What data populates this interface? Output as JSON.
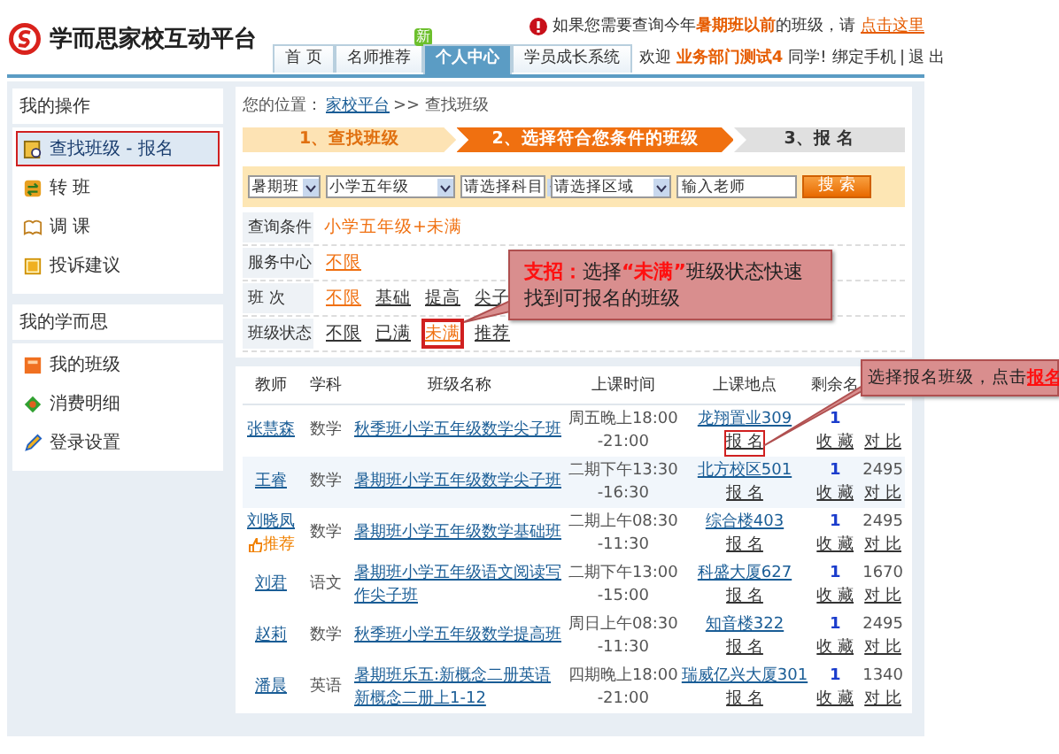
{
  "header": {
    "logo": "学而思家校互动平台",
    "notice": {
      "text": "如果您需要查询今年",
      "highlight": "暑期班以前",
      "tail": "的班级，请",
      "link": "点击这里"
    },
    "nav": [
      {
        "label": "首 页",
        "selected": false
      },
      {
        "label": "名师推荐",
        "selected": false,
        "badge": "新"
      },
      {
        "label": "个人中心",
        "selected": true
      },
      {
        "label": "学员成长系统",
        "selected": false
      }
    ],
    "welcome": {
      "greeting": "欢迎",
      "user": "业务部门测试4",
      "suffix": "同学!",
      "links": [
        "绑定手机",
        "退 出"
      ]
    }
  },
  "sidebar": [
    {
      "title": "我的操作",
      "items": [
        {
          "label": "查找班级 - 报名",
          "kind": "search",
          "selected": true,
          "annotated": true
        },
        {
          "label": "转 班",
          "kind": "swap",
          "selected": false,
          "annotated": false
        },
        {
          "label": "调 课",
          "kind": "book",
          "selected": false,
          "annotated": false
        },
        {
          "label": "投诉建议",
          "kind": "note",
          "selected": false,
          "annotated": false
        }
      ]
    },
    {
      "title": "我的学而思",
      "items": [
        {
          "label": "我的班级",
          "kind": "folder",
          "selected": false,
          "annotated": false
        },
        {
          "label": "消费明细",
          "kind": "leaf",
          "selected": false,
          "annotated": false
        },
        {
          "label": "登录设置",
          "kind": "pencil",
          "selected": false,
          "annotated": false
        }
      ]
    }
  ],
  "main": {
    "breadcrumb": {
      "prefix": "您的位置：",
      "link": "家校平台",
      "current": ">> 查找班级"
    },
    "steps": [
      {
        "label": "1、查找班级",
        "selected": false
      },
      {
        "label": "2、选择符合您条件的班级",
        "selected": true
      },
      {
        "label": "3、报 名",
        "selected": false
      }
    ],
    "search": {
      "selects": [
        "暑期班",
        "小学五年级",
        "请选择科目",
        "请选择区域"
      ],
      "teacher": {
        "placeholder": "输入老师"
      },
      "button": "搜 索"
    },
    "filters": [
      {
        "label": "查询条件",
        "kind": "text",
        "value": "小学五年级+未满"
      },
      {
        "label": "服务中心",
        "kind": "options",
        "options": [
          {
            "label": "不限",
            "selected": true,
            "annotated": false
          }
        ]
      },
      {
        "label": "班  次",
        "kind": "options",
        "options": [
          {
            "label": "不限",
            "selected": true,
            "annotated": false
          },
          {
            "label": "基础",
            "selected": false,
            "annotated": false
          },
          {
            "label": "提高",
            "selected": false,
            "annotated": false
          },
          {
            "label": "尖子",
            "selected": false,
            "annotated": false
          }
        ]
      },
      {
        "label": "班级状态",
        "kind": "options",
        "options": [
          {
            "label": "不限",
            "selected": false,
            "annotated": false
          },
          {
            "label": "已满",
            "selected": false,
            "annotated": false
          },
          {
            "label": "未满",
            "selected": true,
            "annotated": true
          },
          {
            "label": "推荐",
            "selected": false,
            "annotated": false
          }
        ]
      }
    ],
    "table": {
      "columns": [
        "教师",
        "学科",
        "班级名称",
        "上课时间",
        "上课地点",
        "剩余名"
      ],
      "rows": [
        {
          "teacher": "张慧森",
          "subject": "数学",
          "name": "秋季班小学五年级数学尖子班",
          "time": [
            "周五晚上18:00",
            "-21:00"
          ],
          "place": "龙翔置业309",
          "enroll": "报 名",
          "enroll_annotated": true,
          "remaining": "1",
          "favorite": "收 藏",
          "compare": "对 比",
          "highlighted": false
        },
        {
          "teacher": "王睿",
          "subject": "数学",
          "name": "暑期班小学五年级数学尖子班",
          "time": [
            "二期下午13:30",
            "-16:30"
          ],
          "place": "北方校区501",
          "enroll": "报 名",
          "enroll_annotated": false,
          "remaining": "1",
          "favorite": "收 藏",
          "price": "2495",
          "compare": "对 比",
          "highlighted": true
        },
        {
          "teacher": "刘晓凤",
          "tag": "推荐",
          "subject": "数学",
          "name": "暑期班小学五年级数学基础班",
          "time": [
            "二期上午08:30",
            "-11:30"
          ],
          "place": "综合楼403",
          "enroll": "报 名",
          "enroll_annotated": false,
          "remaining": "1",
          "favorite": "收 藏",
          "price": "2495",
          "compare": "对 比",
          "highlighted": false
        },
        {
          "teacher": "刘君",
          "subject": "语文",
          "name": "暑期班小学五年级语文阅读写作尖子班",
          "time": [
            "二期下午13:00",
            "-15:00"
          ],
          "place": "科盛大厦627",
          "enroll": "报 名",
          "enroll_annotated": false,
          "remaining": "1",
          "favorite": "收 藏",
          "price": "1670",
          "compare": "对 比",
          "highlighted": false
        },
        {
          "teacher": "赵莉",
          "subject": "数学",
          "name": "秋季班小学五年级数学提高班",
          "time": [
            "周日上午08:30",
            "-11:30"
          ],
          "place": "知音楼322",
          "enroll": "报 名",
          "enroll_annotated": false,
          "remaining": "1",
          "favorite": "收 藏",
          "price": "2495",
          "compare": "对 比",
          "highlighted": false
        },
        {
          "teacher": "潘晨",
          "subject": "英语",
          "name": "暑期班乐五:新概念二册英语新概念二册上1-12",
          "time": [
            "四期晚上18:00",
            "-21:00"
          ],
          "place": "瑞威亿兴大厦301",
          "enroll": "报 名",
          "enroll_annotated": false,
          "remaining": "1",
          "favorite": "收 藏",
          "price": "1340",
          "compare": "对 比",
          "highlighted": false
        }
      ]
    }
  },
  "callouts": [
    {
      "parts": [
        {
          "text": "支招：",
          "kind": "em"
        },
        {
          "text": "选择",
          "kind": "plain"
        },
        {
          "text": "“未满”",
          "kind": "em"
        },
        {
          "text": "班级状态快速找到可报名的班级",
          "kind": "plain"
        }
      ]
    },
    {
      "parts": [
        {
          "text": "选择报名班级，点击",
          "kind": "plain"
        },
        {
          "text": "报名",
          "kind": "link"
        }
      ]
    }
  ]
}
